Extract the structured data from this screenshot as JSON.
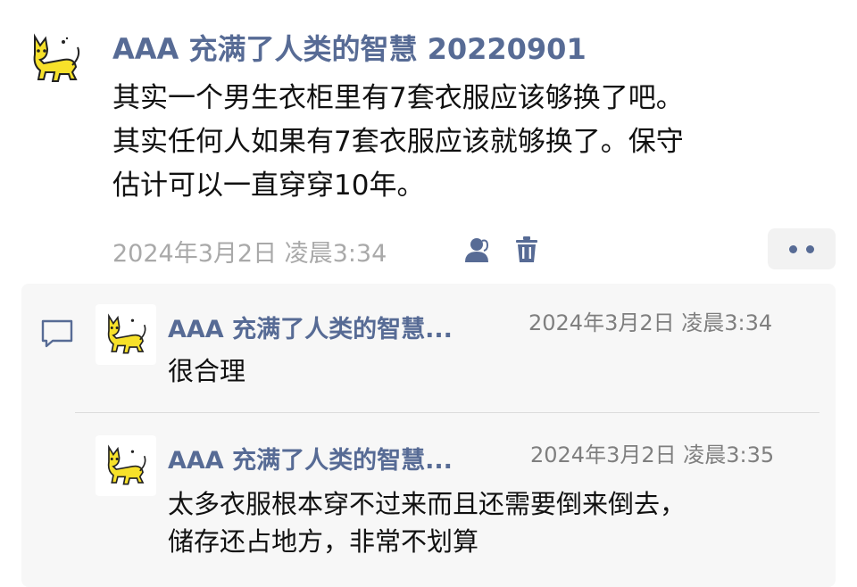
{
  "post": {
    "author": "AAA 充满了人类的智慧 20220901",
    "lines": [
      "其实一个男生衣柜里有7套衣服应该够换了吧。",
      "其实任何人如果有7套衣服应该就够换了。保守",
      "估计可以一直穿穿10年。"
    ],
    "timestamp": "2024年3月2日 凌晨3:34",
    "icons": [
      "contacts-icon",
      "trash-icon",
      "more-icon"
    ]
  },
  "comments": [
    {
      "author": "AAA 充满了人类的智慧...",
      "time": "2024年3月2日 凌晨3:34",
      "lines": [
        "很合理"
      ]
    },
    {
      "author": "AAA 充满了人类的智慧...",
      "time": "2024年3月2日 凌晨3:35",
      "lines": [
        "太多衣服根本穿不过来而且还需要倒来倒去，",
        "储存还占地方，非常不划算"
      ]
    }
  ],
  "colors": {
    "link": "#576b95",
    "meta": "#a9a9a9",
    "comment_bg": "#f7f7f7",
    "cat": "#f7e12a"
  }
}
